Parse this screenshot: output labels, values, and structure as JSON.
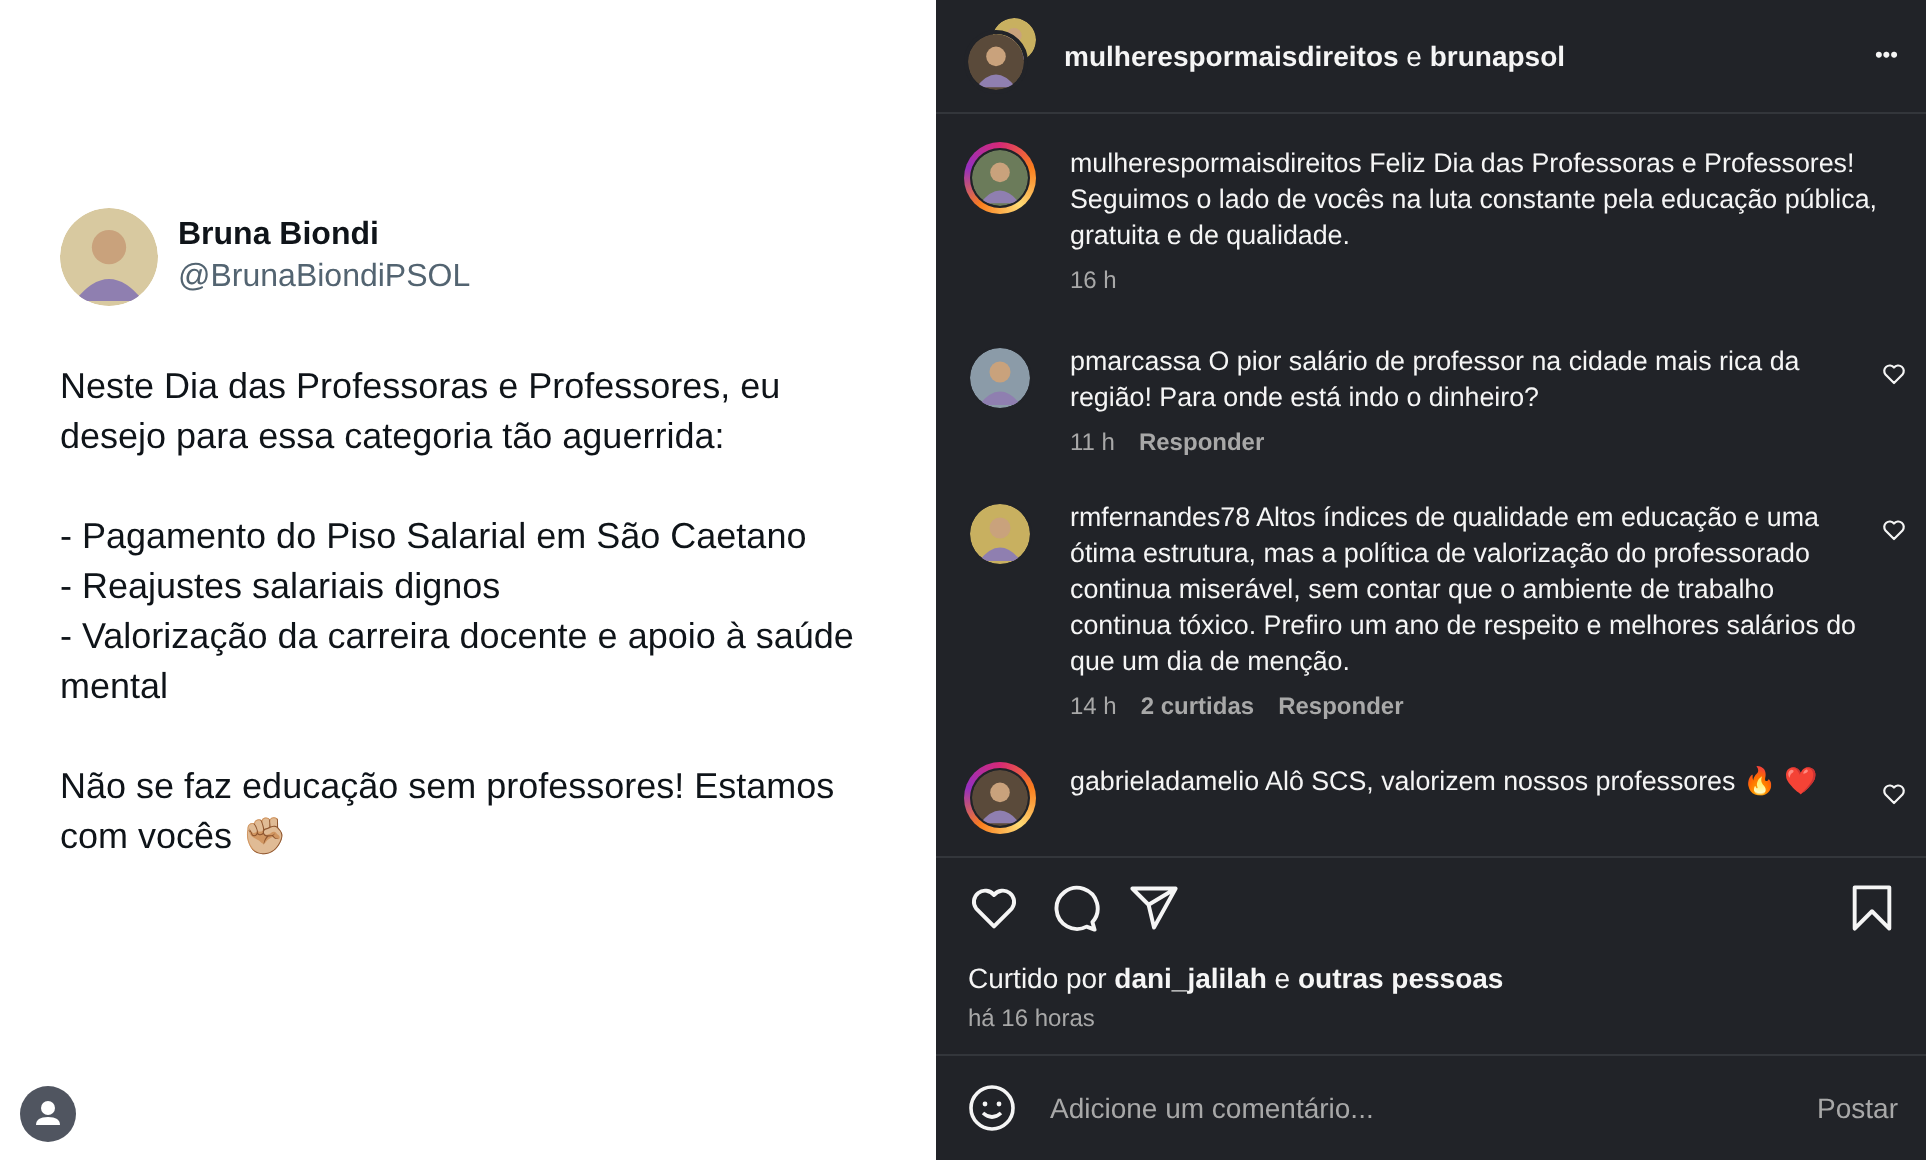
{
  "tweet": {
    "name": "Bruna Biondi",
    "handle": "@BrunaBiondiPSOL",
    "paragraphs": [
      "Neste Dia das Professoras e Professores, eu desejo para essa categoria tão aguerrida:",
      "- Pagamento do Piso Salarial em São Caetano\n- Reajustes salariais dignos\n- Valorização da carreira docente e apoio à saúde mental",
      "Não se faz educação sem professores! Estamos com vocês ✊🏼"
    ]
  },
  "post": {
    "header": {
      "account": "mulherespormaisdireitos",
      "joiner": "e",
      "collaborator": "brunapsol",
      "more": "•••"
    },
    "comments": [
      {
        "kind": "caption",
        "user": "mulherespormaisdireitos",
        "text": "Feliz Dia das Professoras e Professores! Seguimos o lado de vocês na luta constante pela educação pública, gratuita e de qualidade.",
        "story_ring": true,
        "meta": [
          "16 h"
        ]
      },
      {
        "kind": "comment",
        "user": "pmarcassa",
        "text": "O pior salário de professor na cidade mais rica da região! Para onde está indo o dinheiro?",
        "story_ring": false,
        "meta": [
          "11 h",
          "Responder"
        ]
      },
      {
        "kind": "comment",
        "user": "rmfernandes78",
        "text": "Altos índices de qualidade em educação e uma ótima estrutura, mas a política de valorização do professorado continua miserável, sem contar que o ambiente de trabalho continua tóxico. Prefiro um ano de respeito e melhores salários do que um dia de menção.",
        "story_ring": false,
        "meta": [
          "14 h",
          "2 curtidas",
          "Responder"
        ]
      },
      {
        "kind": "comment",
        "user": "gabrieladamelio",
        "text": "Alô SCS, valorizem nossos professores 🔥 ❤️",
        "story_ring": true
      }
    ],
    "liked_by": "Curtido por **dani_jalilah** e **outras pessoas**",
    "time": "há 16 horas",
    "add_comment": {
      "placeholder": "Adicione um comentário...",
      "button": "Postar"
    }
  }
}
